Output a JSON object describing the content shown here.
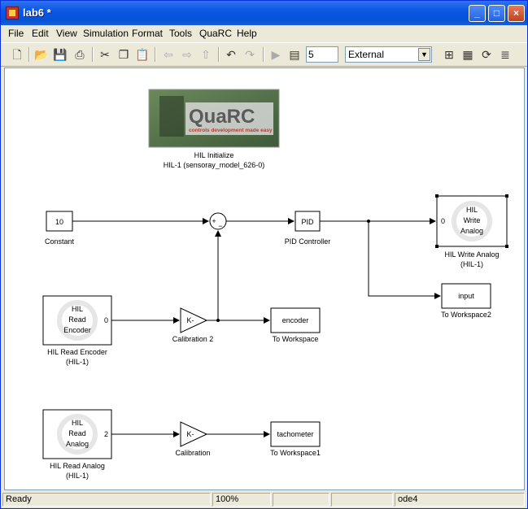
{
  "window": {
    "title": "lab6 *",
    "min_icon": "_",
    "max_icon": "□",
    "close_icon": "×"
  },
  "menu": [
    "File",
    "Edit",
    "View",
    "Simulation",
    "Format",
    "Tools",
    "QuaRC",
    "Help"
  ],
  "toolbar": {
    "stop_time": "5",
    "mode": "External",
    "tools": [
      "new-file-icon",
      "open-folder-icon",
      "save-icon",
      "print-icon",
      "cut-icon",
      "copy-icon",
      "paste-icon",
      "back-arrow-icon",
      "forward-arrow-icon",
      "up-arrow-icon",
      "undo-icon",
      "redo-icon",
      "play-icon",
      "build-icon",
      "library-icon",
      "refresh-icon",
      "stack-icon"
    ]
  },
  "diagram": {
    "quarc_logo": {
      "brand": "QuaRC",
      "tagline": "controls development made easy"
    },
    "hil_initialize": {
      "label1": "HIL Initialize",
      "label2": "HIL-1 (sensoray_model_626-0)"
    },
    "constant": {
      "value": "10",
      "label": "Constant"
    },
    "sum": {
      "plus": "+",
      "minus": "−"
    },
    "pid": {
      "text": "PID",
      "label": "PID Controller"
    },
    "hil_write_analog": {
      "line1": "HIL",
      "line2": "Write",
      "line3": "Analog",
      "port": "0",
      "label1": "HIL Write Analog",
      "label2": "(HIL-1)"
    },
    "to_workspace2": {
      "text": "input",
      "label": "To Workspace2"
    },
    "hil_read_encoder": {
      "line1": "HIL",
      "line2": "Read",
      "line3": "Encoder",
      "port": "0",
      "label1": "HIL Read Encoder",
      "label2": "(HIL-1)"
    },
    "calibration2": {
      "text": "K-",
      "label": "Calibration 2"
    },
    "to_workspace": {
      "text": "encoder",
      "label": "To Workspace"
    },
    "hil_read_analog": {
      "line1": "HIL",
      "line2": "Read",
      "line3": "Analog",
      "port": "2",
      "label1": "HIL Read Analog",
      "label2": "(HIL-1)"
    },
    "calibration": {
      "text": "K-",
      "label": "Calibration"
    },
    "to_workspace1": {
      "text": "tachometer",
      "label": "To Workspace1"
    }
  },
  "status": {
    "state": "Ready",
    "zoom": "100%",
    "solver": "ode4"
  }
}
